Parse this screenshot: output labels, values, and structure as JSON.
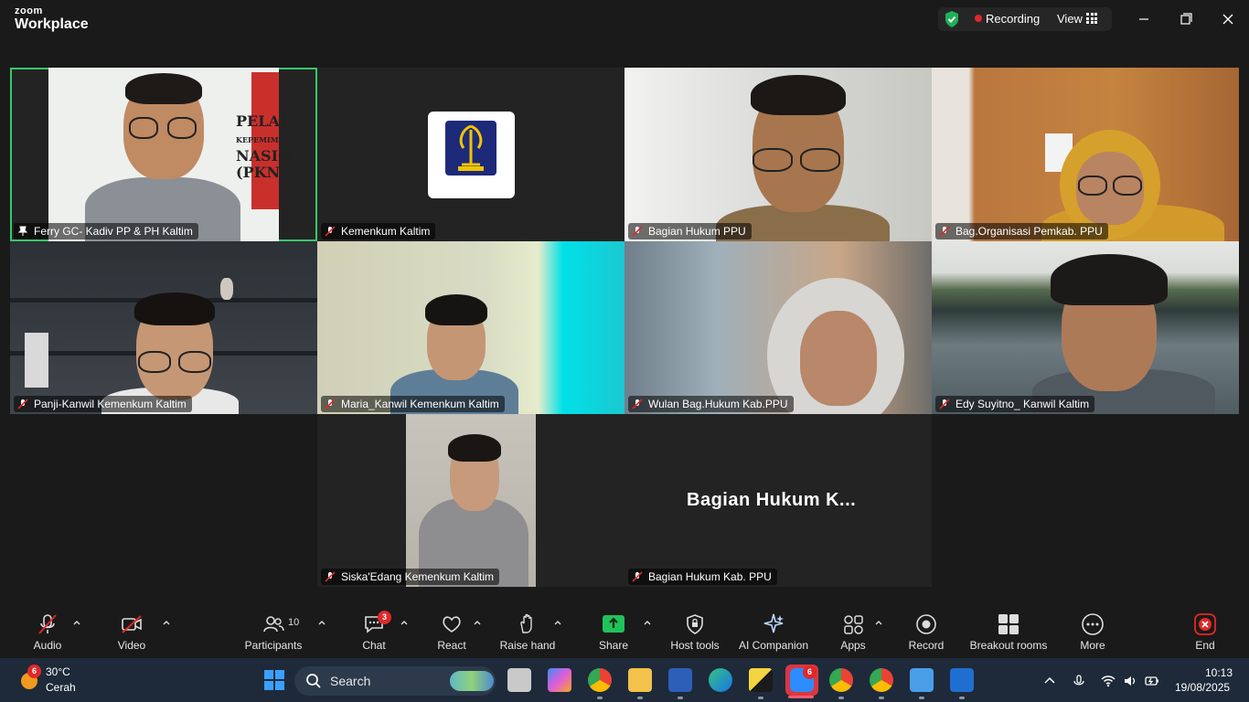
{
  "app": {
    "brand_top": "zoom",
    "brand_bottom": "Workplace"
  },
  "titlebar": {
    "recording_label": "Recording",
    "view_label": "View"
  },
  "tiles": [
    {
      "name": "Ferry GC- Kadiv PP & PH Kaltim"
    },
    {
      "name": "Kemenkum Kaltim"
    },
    {
      "name": "Bagian Hukum PPU"
    },
    {
      "name": "Bag.Organisasi Pemkab. PPU"
    },
    {
      "name": "Panji-Kanwil Kemenkum Kaltim"
    },
    {
      "name": "Maria_Kanwil Kemenkum Kaltim"
    },
    {
      "name": "Wulan Bag.Hukum Kab.PPU"
    },
    {
      "name": "Edy Suyitno_ Kanwil Kaltim"
    },
    {
      "name": "Siska'Edang Kemenkum Kaltim"
    },
    {
      "name": "Bagian Hukum Kab. PPU",
      "display": "Bagian Hukum K..."
    }
  ],
  "toolbar": {
    "audio": "Audio",
    "video": "Video",
    "participants": "Participants",
    "participants_count": "10",
    "chat": "Chat",
    "chat_badge": "3",
    "react": "React",
    "raise_hand": "Raise hand",
    "share": "Share",
    "host_tools": "Host tools",
    "ai_companion": "AI Companion",
    "apps": "Apps",
    "record": "Record",
    "breakout_rooms": "Breakout rooms",
    "more": "More",
    "end": "End"
  },
  "taskbar": {
    "weather_badge": "6",
    "temperature": "30°C",
    "condition": "Cerah",
    "search_placeholder": "Search",
    "zoom_badge": "6",
    "time": "10:13",
    "date": "19/08/2025"
  },
  "colors": {
    "active_border": "#37c86b",
    "recording": "#e02828",
    "share_green": "#1fc35a",
    "shield_green": "#1fb157"
  }
}
